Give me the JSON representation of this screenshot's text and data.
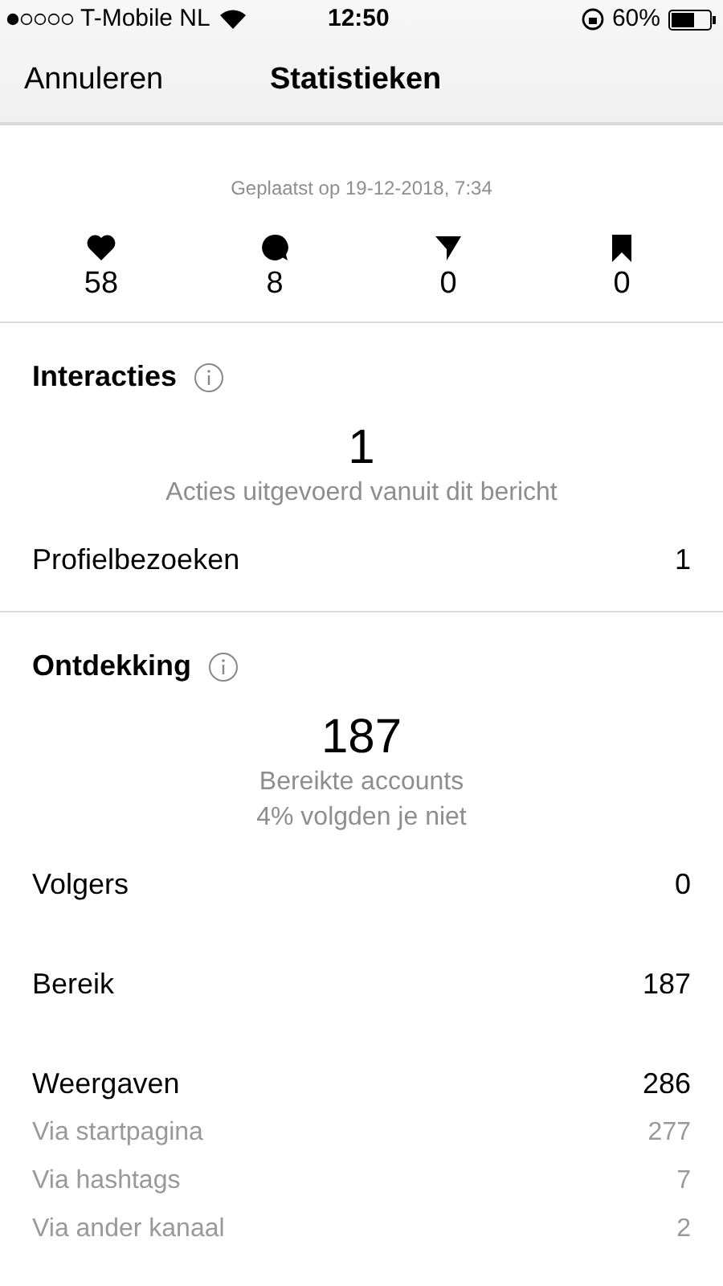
{
  "status_bar": {
    "carrier": "T-Mobile NL",
    "time": "12:50",
    "battery": "60%"
  },
  "nav": {
    "cancel": "Annuleren",
    "title": "Statistieken"
  },
  "posted": "Geplaatst op 19-12-2018, 7:34",
  "counts": [
    {
      "kind": "heart",
      "value": "58"
    },
    {
      "kind": "comment",
      "value": "8"
    },
    {
      "kind": "send",
      "value": "0"
    },
    {
      "kind": "bookmark",
      "value": "0"
    }
  ],
  "sections": [
    {
      "title": "Interacties",
      "big": "1",
      "captions": [
        "Acties uitgevoerd vanuit dit bericht"
      ],
      "rows": [
        {
          "kind": "main",
          "label": "Profielbezoeken",
          "value": "1"
        }
      ]
    },
    {
      "title": "Ontdekking",
      "big": "187",
      "captions": [
        "Bereikte accounts",
        "4% volgden je niet"
      ],
      "rows": [
        {
          "kind": "main",
          "label": "Volgers",
          "value": "0"
        },
        {
          "kind": "main",
          "label": "Bereik",
          "value": "187"
        },
        {
          "kind": "main",
          "label": "Weergaven",
          "value": "286"
        },
        {
          "kind": "sub",
          "label": "Via startpagina",
          "value": "277"
        },
        {
          "kind": "sub",
          "label": "Via hashtags",
          "value": "7"
        },
        {
          "kind": "sub",
          "label": "Via ander kanaal",
          "value": "2"
        }
      ]
    }
  ]
}
